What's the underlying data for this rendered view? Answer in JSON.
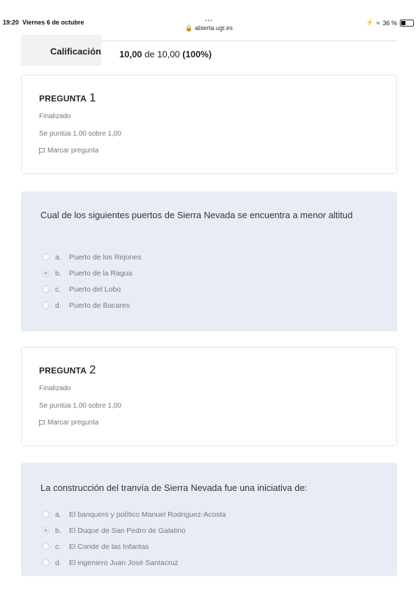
{
  "status_bar": {
    "time": "19:20",
    "date": "Viernes 6 de octubre",
    "dots": "•••",
    "url": "abierta.ugr.es",
    "battery_text": "36 %"
  },
  "summary": {
    "label": "Calificación",
    "score": "10,00",
    "of_text": "de 10,00",
    "percent": "(100%)"
  },
  "questions": [
    {
      "title": "PREGUNTA",
      "number": "1",
      "state": "Finalizado",
      "grade": "Se puntúa 1,00 sobre 1,00",
      "flag_label": "Marcar pregunta",
      "text": "Cual de los siguientes puertos de Sierra Nevada se encuentra a menor altitud",
      "answers": [
        {
          "letter": "a.",
          "text": "Puerto de los Rejones",
          "selected": false
        },
        {
          "letter": "b.",
          "text": "Puerto de la Ragua",
          "selected": true
        },
        {
          "letter": "c.",
          "text": "Puerto del Lobo",
          "selected": false
        },
        {
          "letter": "d.",
          "text": "Puerto de Bacares",
          "selected": false
        }
      ]
    },
    {
      "title": "PREGUNTA",
      "number": "2",
      "state": "Finalizado",
      "grade": "Se puntúa 1,00 sobre 1,00",
      "flag_label": "Marcar pregunta",
      "text": "La construcción del tranvía de Sierra Nevada fue una iniciativa de:",
      "answers": [
        {
          "letter": "a.",
          "text": "El banquero y político Manuel Rodriguez-Acosta",
          "selected": false
        },
        {
          "letter": "b.",
          "text": "El Duque de San Pedro de Galatino",
          "selected": true
        },
        {
          "letter": "c.",
          "text": "El Conde de las Infantas",
          "selected": false
        },
        {
          "letter": "d.",
          "text": "El ingeniero Juan José Santacruz",
          "selected": false
        }
      ]
    }
  ]
}
